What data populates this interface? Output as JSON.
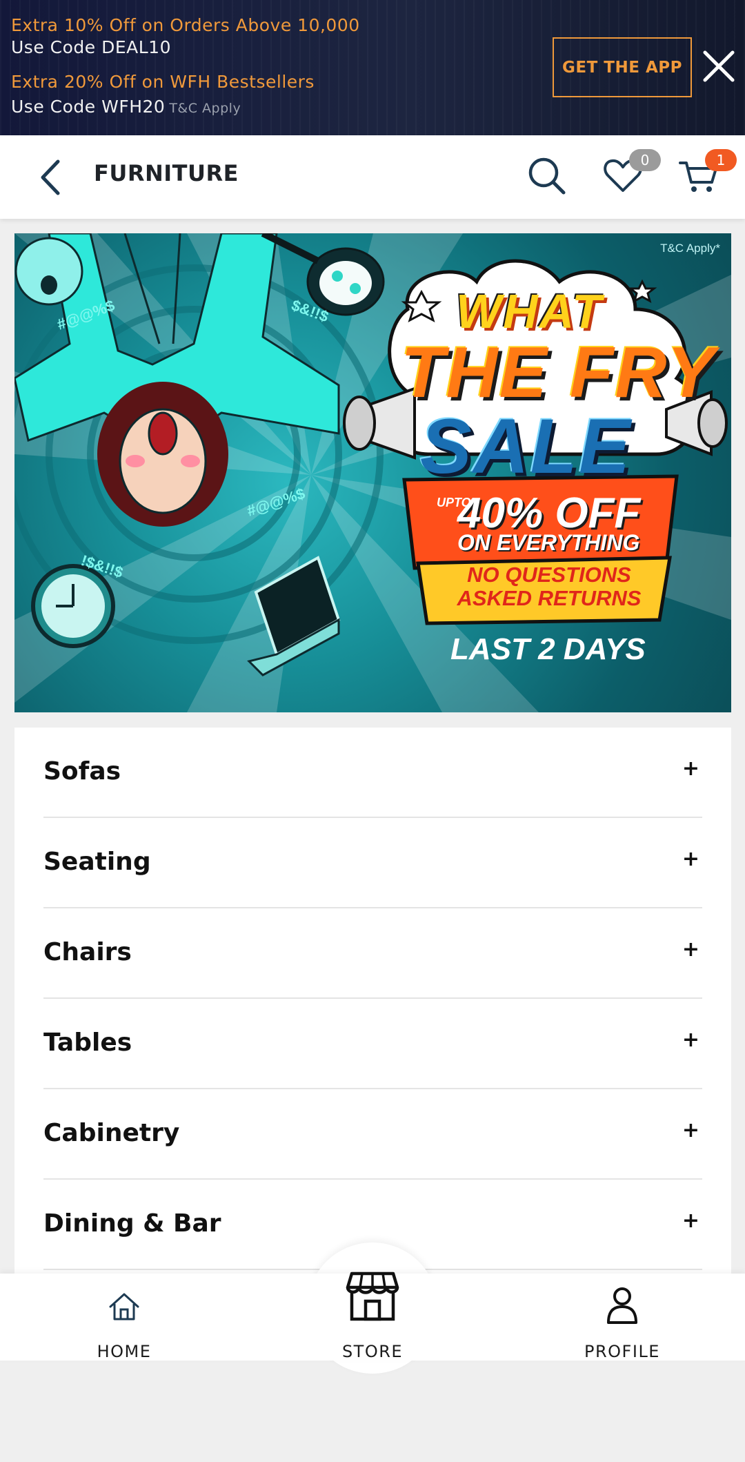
{
  "promo": {
    "line1": "Extra 10% Off on Orders Above 10,000",
    "line2": "Use Code DEAL10",
    "line3": "Extra 20% Off on WFH Bestsellers",
    "line4": "Use Code WFH20",
    "line4_note": "T&C Apply",
    "cta": "GET THE APP",
    "close_icon": "close-icon"
  },
  "header": {
    "title": "FURNITURE",
    "back_icon": "chevron-left-icon",
    "wishlist_count": "0",
    "cart_count": "1"
  },
  "banner": {
    "tc": "T&C Apply*",
    "line1": "WHAT",
    "line2": "THE FRY",
    "line3": "SALE",
    "upto": "UPTO",
    "discount": "40% OFF",
    "on_everything": "ON EVERYTHING",
    "returns_line1": "NO QUESTIONS",
    "returns_line2": "ASKED RETURNS",
    "last_days": "LAST 2 DAYS"
  },
  "categories": [
    {
      "label": "Sofas",
      "expand": "+"
    },
    {
      "label": "Seating",
      "expand": "+"
    },
    {
      "label": "Chairs",
      "expand": "+"
    },
    {
      "label": "Tables",
      "expand": "+"
    },
    {
      "label": "Cabinetry",
      "expand": "+"
    },
    {
      "label": "Dining & Bar",
      "expand": "+"
    }
  ],
  "nav": {
    "home": "HOME",
    "store": "STORE",
    "profile": "PROFILE"
  },
  "colors": {
    "accent_orange": "#f0993a",
    "cart_badge": "#f15a22",
    "promo_bg": "#1a2140"
  }
}
